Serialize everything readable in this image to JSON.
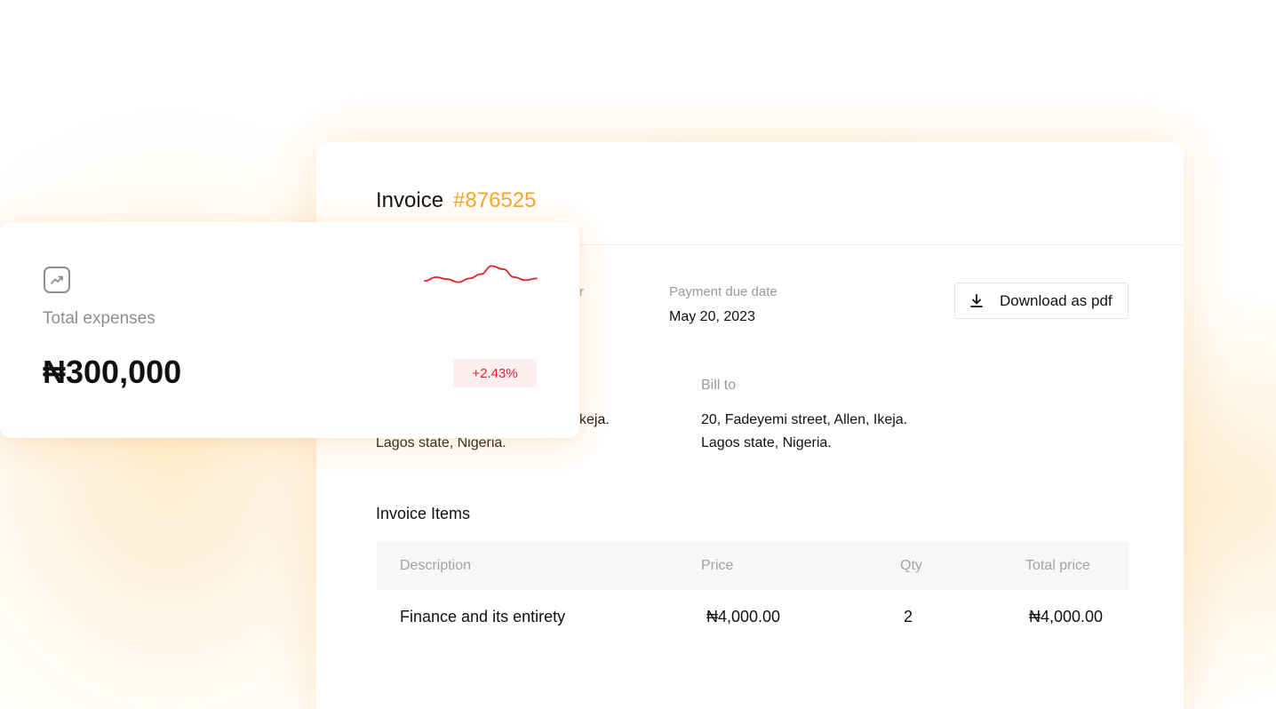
{
  "invoice": {
    "title": "Invoice",
    "number": "#876525",
    "left_label_fragment": "r",
    "payment_due_label": "Payment due date",
    "payment_due_value": "May 20, 2023",
    "download_label": "Download as pdf",
    "from_line1_fragment": "keja.",
    "from_line2": "Lagos state, Nigeria.",
    "bill_to_label": "Bill to",
    "bill_to_line1": "20, Fadeyemi street, Allen, Ikeja.",
    "bill_to_line2": "Lagos state, Nigeria.",
    "items_title": "Invoice Items",
    "columns": [
      "Description",
      "Price",
      "Qty",
      "Total price"
    ],
    "rows": [
      {
        "description": "Finance and its entirety",
        "price": "₦4,000.00",
        "qty": "2",
        "total": "₦4,000.00"
      }
    ]
  },
  "expenses": {
    "label": "Total expenses",
    "amount": "₦300,000",
    "change": "+2.43%",
    "icon": "trending-up-icon",
    "sparkline_values": [
      0.35,
      0.5,
      0.42,
      0.3,
      0.45,
      0.62,
      0.95,
      0.82,
      0.5,
      0.38,
      0.45
    ],
    "sparkline_color": "#e0202b"
  },
  "colors": {
    "accent": "#f5a623",
    "negative_text": "#e0202b",
    "badge_bg": "#fdeef0"
  }
}
